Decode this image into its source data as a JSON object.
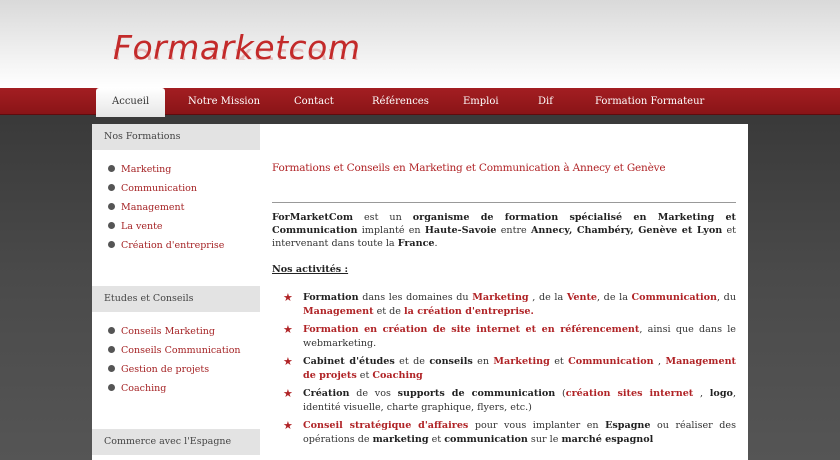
{
  "brand": {
    "logo": "Formarketcom",
    "accent": "#b02326"
  },
  "nav": {
    "items": [
      {
        "label": "Accueil",
        "active": true
      },
      {
        "label": "Notre Mission"
      },
      {
        "label": "Contact"
      },
      {
        "label": "Références"
      },
      {
        "label": "Emploi"
      },
      {
        "label": "Dif"
      },
      {
        "label": "Formation Formateur"
      }
    ]
  },
  "sidebar": {
    "sections": [
      {
        "title": "Nos Formations",
        "items": [
          "Marketing",
          "Communication",
          "Management",
          "La vente",
          "Création d'entreprise"
        ]
      },
      {
        "title": "Etudes et Conseils",
        "items": [
          "Conseils Marketing",
          "Conseils Communication",
          "Gestion de projets",
          "Coaching"
        ]
      },
      {
        "title": "Commerce avec l'Espagne",
        "items": []
      }
    ]
  },
  "main": {
    "title": "Formations et Conseils en Marketing et Communication à Annecy et Genève",
    "intro": {
      "p1": "ForMarketCom",
      "p2": " est un ",
      "p3": "organisme de formation spécialisé en Marketing et Communication",
      "p4": " implanté en ",
      "p5": "Haute-Savoie",
      "p6": " entre ",
      "p7": "Annecy, Chambéry, Genève et Lyon",
      "p8": " et intervenant dans toute la ",
      "p9": "France",
      "p10": "."
    },
    "activities_heading": "Nos activités :",
    "activities": {
      "a1": {
        "t1": "Formation",
        "t2": " dans les domaines du ",
        "t3": "Marketing",
        "t4": " , de la ",
        "t5": "Vente",
        "t6": ", de la ",
        "t7": "Communication",
        "t8": ", du ",
        "t9": "Management",
        "t10": " et de ",
        "t11": "la création d'entreprise."
      },
      "a2": {
        "t1": " Formation en création de site internet et en référencement",
        "t2": ", ainsi que dans le webmarketing."
      },
      "a3": {
        "t1": "Cabinet d'études",
        "t2": " et de ",
        "t3": "conseils",
        "t4": " en ",
        "t5": "Marketing",
        "t6": " et ",
        "t7": "Communication",
        "t8": " , ",
        "t9": "Management de projets",
        "t10": " et ",
        "t11": "Coaching"
      },
      "a4": {
        "t1": "Création",
        "t2": " de vos ",
        "t3": "supports de communication",
        "t4": " (",
        "t5": "création sites internet",
        "t6": " , ",
        "t7": "logo",
        "t8": ", identité visuelle, charte graphique, flyers, etc.)"
      },
      "a5": {
        "t1": "Conseil stratégique d'affaires",
        "t2": " pour vous implanter en ",
        "t3": "Espagne",
        "t4": " ou réaliser des opérations de ",
        "t5": "marketing",
        "t6": " et ",
        "t7": "communication",
        "t8": " sur le ",
        "t9": "marché espagnol"
      }
    }
  }
}
